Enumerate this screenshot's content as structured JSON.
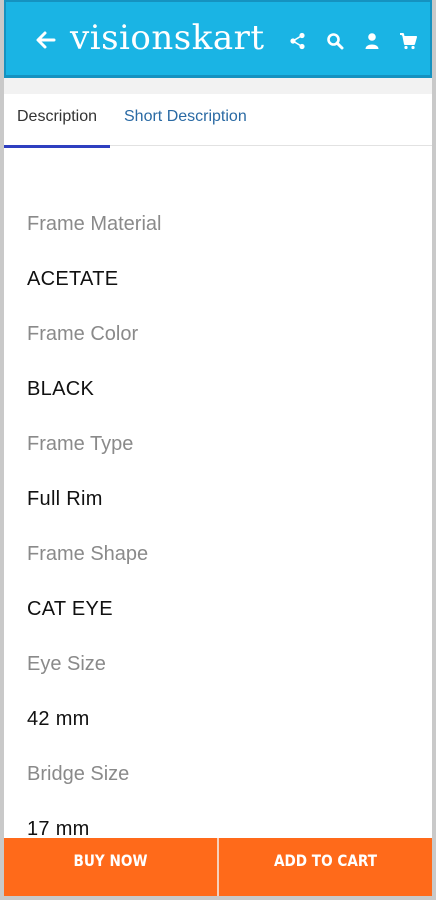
{
  "header": {
    "brand": "visionskart",
    "icons": [
      "back-arrow-icon",
      "share-icon",
      "search-icon",
      "user-icon",
      "cart-icon"
    ],
    "bg_color": "#1ab4e4"
  },
  "tabs": [
    {
      "label": "Description",
      "active": true
    },
    {
      "label": "Short Description",
      "active": false
    }
  ],
  "specs": [
    {
      "label": "Frame Material",
      "value": "ACETATE"
    },
    {
      "label": "Frame Color",
      "value": "BLACK"
    },
    {
      "label": "Frame Type",
      "value": "Full Rim"
    },
    {
      "label": "Frame Shape",
      "value": "CAT EYE"
    },
    {
      "label": "Eye Size",
      "value": "42 mm"
    },
    {
      "label": "Bridge Size",
      "value": "17 mm"
    }
  ],
  "actions": {
    "buy_now": "BUY NOW",
    "add_to_cart": "ADD TO CART",
    "accent": "#ff6a1a"
  }
}
